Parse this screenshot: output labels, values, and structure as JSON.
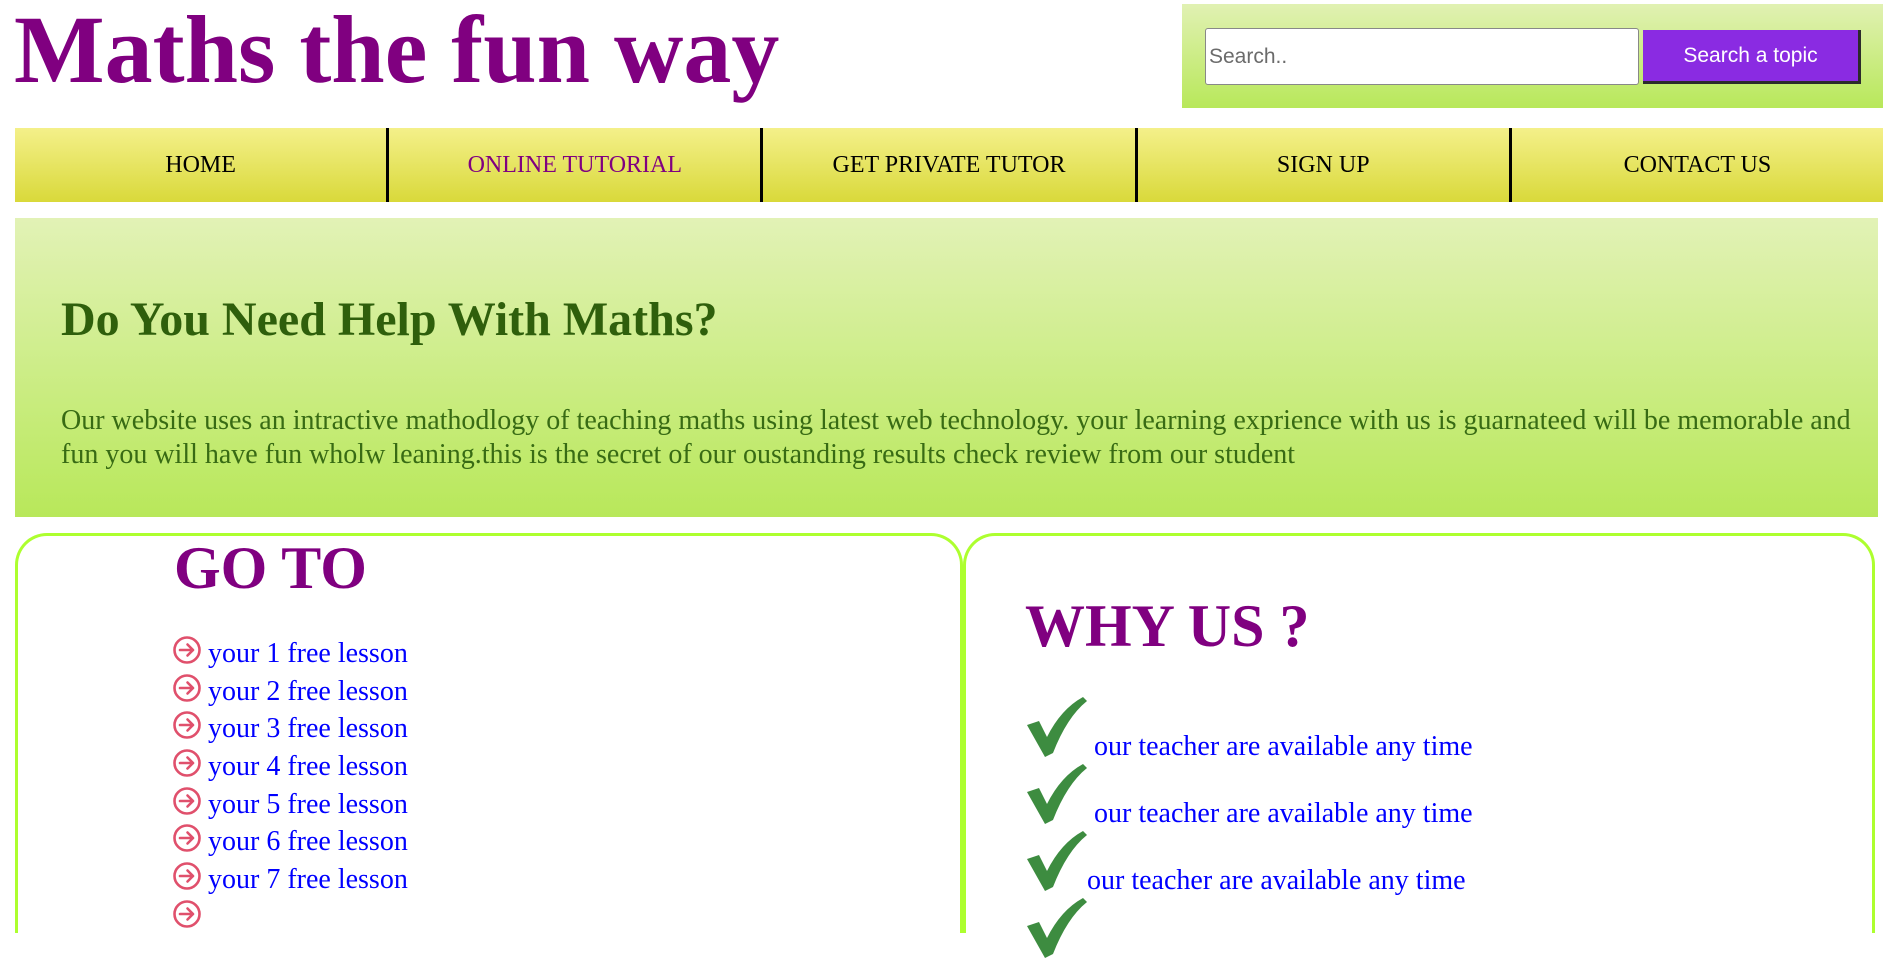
{
  "header": {
    "title": "Maths the fun way",
    "search_placeholder": "Search..",
    "search_button_label": "Search a topic"
  },
  "nav": {
    "items": [
      {
        "label": "HOME",
        "active": false
      },
      {
        "label": "ONLINE TUTORIAL",
        "active": true
      },
      {
        "label": "GET PRIVATE TUTOR",
        "active": false
      },
      {
        "label": "SIGN UP",
        "active": false
      },
      {
        "label": "CONTACT US",
        "active": false
      }
    ]
  },
  "hero": {
    "heading": "Do You Need Help With Maths?",
    "text": "Our website uses an intractive mathodlogy of teaching maths using latest web technology. your learning exprience with us is guarnateed will be memorable and fun you will have fun wholw leaning.this is the secret of our oustanding results check review from our student"
  },
  "goto": {
    "heading": "GO TO",
    "lessons": [
      "your 1 free lesson",
      "your 2 free lesson",
      "your 3 free lesson",
      "your 4 free lesson",
      "your 5 free lesson",
      "your 6 free lesson",
      "your 7 free lesson"
    ]
  },
  "why_us": {
    "heading": "WHY US ?",
    "reasons": [
      "our teacher are available any time",
      "our teacher are available any time",
      "our teacher are available any time"
    ]
  },
  "icons": {
    "lesson_bullet": "arrow-right-circle-icon",
    "reason_bullet": "checkmark-icon"
  },
  "colors": {
    "brand_purple": "#800080",
    "button_purple": "#8a2be2",
    "link_blue": "#0000ff",
    "heading_green": "#2f5f0c",
    "panel_border": "#adff2f",
    "nav_yellow": "#e6e35a",
    "check_green": "#3d8c40",
    "arrow_pink": "#e0506c"
  }
}
